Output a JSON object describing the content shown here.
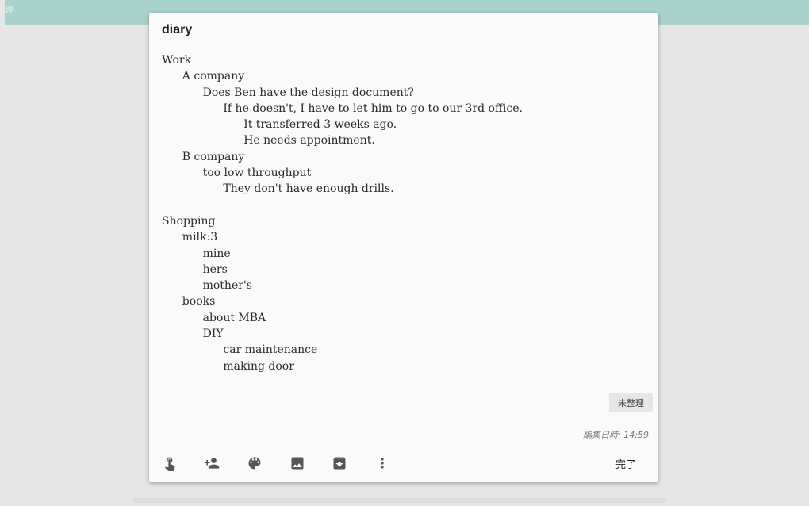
{
  "top_bar": {
    "corner_glyph": "理",
    "color": "#a9d2cd"
  },
  "note": {
    "title": "diary",
    "lines": [
      {
        "indent": 0,
        "text": "Work"
      },
      {
        "indent": 1,
        "text": "A company"
      },
      {
        "indent": 2,
        "text": "Does Ben have the design document?"
      },
      {
        "indent": 3,
        "text": "If he doesn't, I have to let him to go to our 3rd office."
      },
      {
        "indent": 4,
        "text": "It transferred 3 weeks ago."
      },
      {
        "indent": 4,
        "text": "He needs appointment."
      },
      {
        "indent": 1,
        "text": "B company"
      },
      {
        "indent": 2,
        "text": "too low throughput"
      },
      {
        "indent": 3,
        "text": "They don't have enough drills."
      },
      {
        "indent": 0,
        "text": ""
      },
      {
        "indent": 0,
        "text": "Shopping"
      },
      {
        "indent": 1,
        "text": "milk:3"
      },
      {
        "indent": 2,
        "text": "mine"
      },
      {
        "indent": 2,
        "text": "hers"
      },
      {
        "indent": 2,
        "text": "mother's"
      },
      {
        "indent": 1,
        "text": "books"
      },
      {
        "indent": 2,
        "text": "about MBA"
      },
      {
        "indent": 2,
        "text": "DIY"
      },
      {
        "indent": 3,
        "text": "car maintenance"
      },
      {
        "indent": 3,
        "text": "making door"
      }
    ],
    "label_chip": "未整理",
    "edited_time": "編集日時: 14:59"
  },
  "toolbar": {
    "icons": [
      {
        "name": "reminder-touch-icon"
      },
      {
        "name": "add-collaborator-icon"
      },
      {
        "name": "palette-icon"
      },
      {
        "name": "image-icon"
      },
      {
        "name": "archive-icon"
      },
      {
        "name": "more-vert-icon"
      }
    ],
    "done_label": "完了"
  },
  "colors": {
    "background": "#e6e6e6",
    "card": "#fafafa",
    "icon": "#555555"
  }
}
